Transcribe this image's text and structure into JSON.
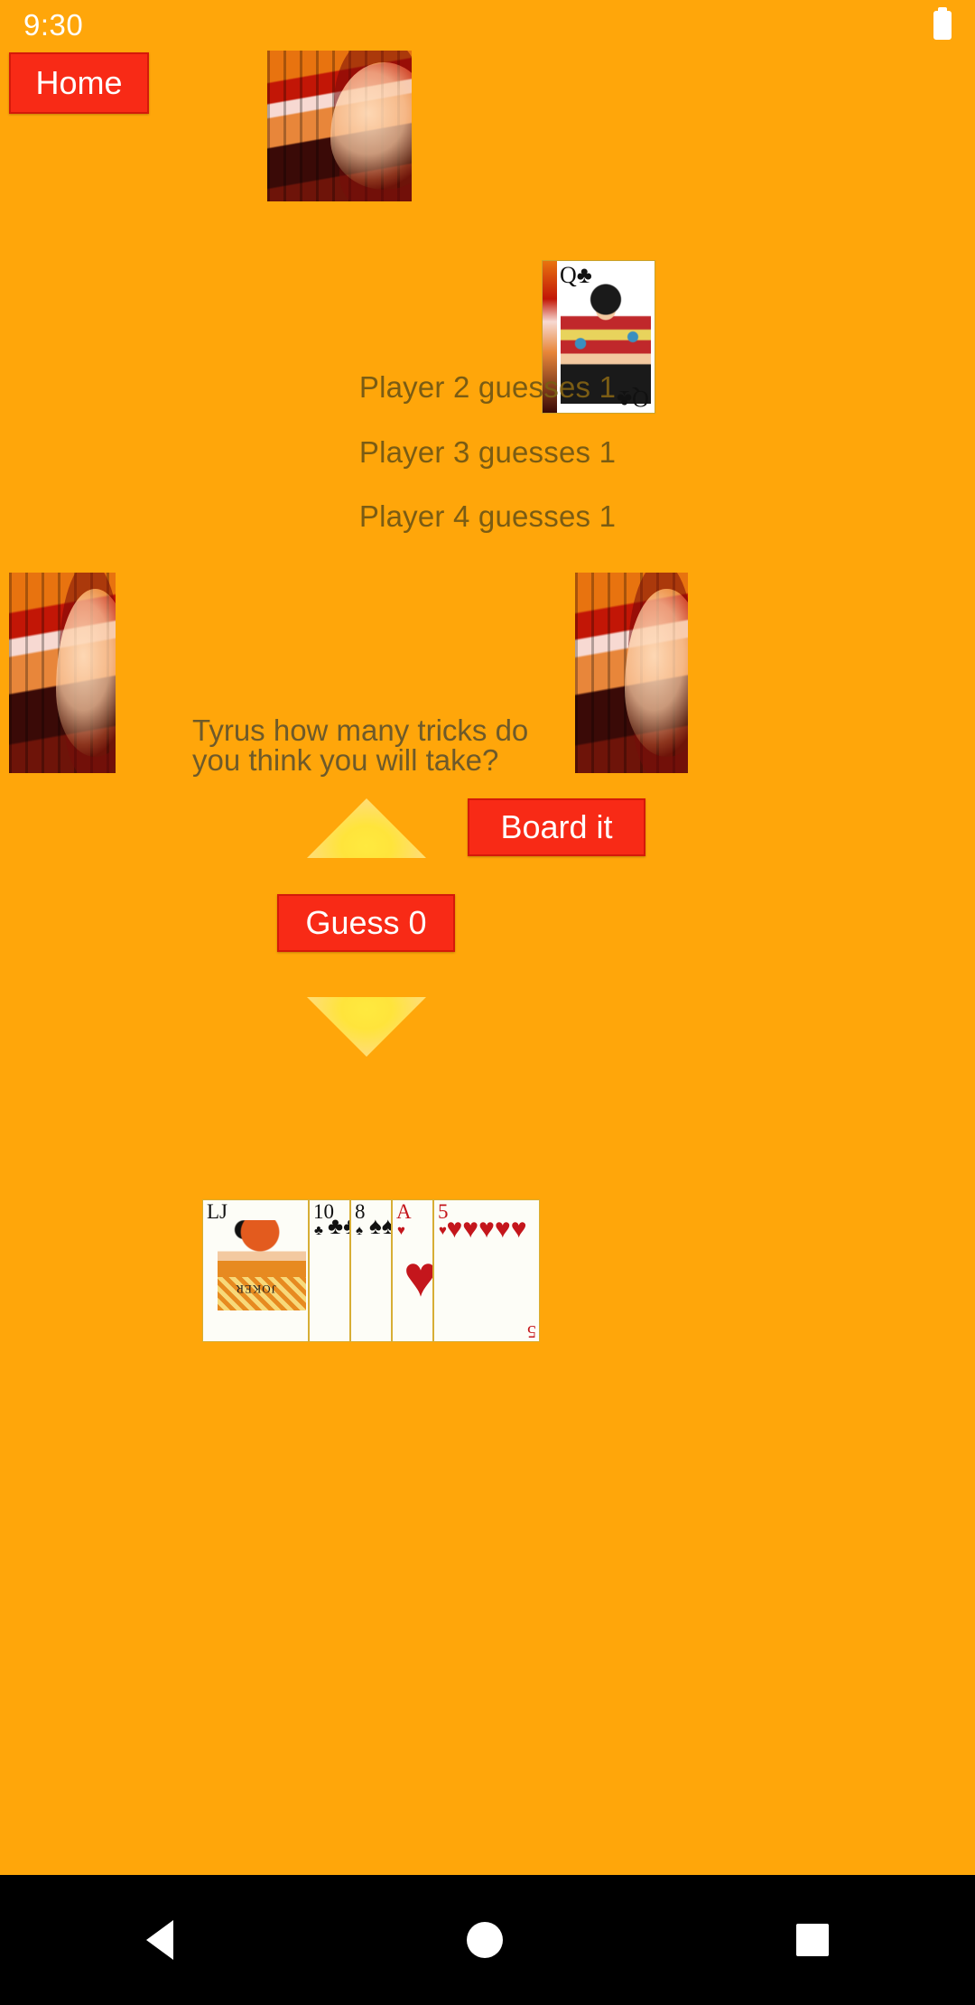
{
  "status_bar": {
    "time": "9:30",
    "battery_icon": "battery-full-icon"
  },
  "theme": {
    "background": "#FFA60A",
    "button_bg": "#F82A16",
    "button_border": "#D4190A",
    "button_text": "#FFFFFF",
    "body_text": "#7A5C14",
    "arrow_color": "#FFE43B"
  },
  "top_bar": {
    "home_label": "Home"
  },
  "table": {
    "top_player_cardback": "card-back",
    "left_player_cardback": "card-back",
    "right_player_cardback": "card-back",
    "trump_card": {
      "rank": "Q",
      "suit": "♣",
      "label": "Q♣",
      "name": "queen-of-clubs"
    }
  },
  "guesses": [
    {
      "text": "Player 2 guesses 1",
      "player": "Player 2",
      "value": 1
    },
    {
      "text": "Player 3 guesses 1",
      "player": "Player 3",
      "value": 1
    },
    {
      "text": "Player 4 guesses 1",
      "player": "Player 4",
      "value": 1
    }
  ],
  "prompt": {
    "text": "Tyrus how many tricks do you think you will take?",
    "player_name": "Tyrus"
  },
  "controls": {
    "increase_arrow": "triangle-up-icon",
    "decrease_arrow": "triangle-down-icon",
    "board_it_label": "Board it",
    "guess_label": "Guess 0",
    "guess_value": 0
  },
  "hand": [
    {
      "rank": "LJ",
      "suit": "",
      "name": "little-joker",
      "red": false,
      "wide": true,
      "pips": "",
      "corner": "LJ"
    },
    {
      "rank": "10",
      "suit": "♣",
      "name": "ten-of-clubs",
      "red": false,
      "wide": false,
      "pips": "♣♣♣♣♣♣",
      "corner": "10"
    },
    {
      "rank": "8",
      "suit": "♠",
      "name": "eight-of-spades",
      "red": false,
      "wide": false,
      "pips": "♠♠♠♠",
      "corner": "8"
    },
    {
      "rank": "A",
      "suit": "♥",
      "name": "ace-of-hearts",
      "red": true,
      "wide": false,
      "pips": "♥",
      "corner": "A"
    },
    {
      "rank": "5",
      "suit": "♥",
      "name": "five-of-hearts",
      "red": true,
      "wide": true,
      "pips": "♥♥♥♥♥",
      "corner": "5"
    }
  ],
  "nav_bar": {
    "back": "triangle-back-icon",
    "home": "circle-home-icon",
    "recents": "square-recents-icon"
  }
}
